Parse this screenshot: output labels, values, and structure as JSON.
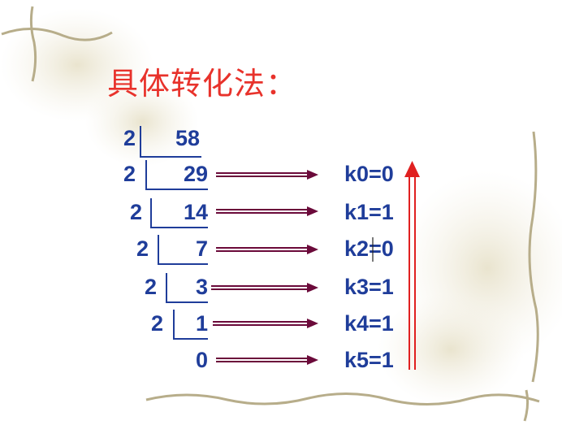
{
  "title": "具体转化法：",
  "division": {
    "divisor": "2",
    "rows": [
      {
        "divisor": "2",
        "value": "58"
      },
      {
        "divisor": "2",
        "value": "29"
      },
      {
        "divisor": "2",
        "value": "14"
      },
      {
        "divisor": "2",
        "value": "7"
      },
      {
        "divisor": "2",
        "value": "3"
      },
      {
        "divisor": "2",
        "value": "1"
      },
      {
        "divisor": "",
        "value": "0"
      }
    ]
  },
  "remainders": [
    {
      "label": "k0=0"
    },
    {
      "label": "k1=1"
    },
    {
      "label": "k2=0"
    },
    {
      "label": "k3=1"
    },
    {
      "label": "k4=1"
    },
    {
      "label": "k5=1"
    }
  ],
  "colors": {
    "title": "#e8322b",
    "text": "#1f3d9a",
    "arrow": "#6b0a3a",
    "up_arrow": "#e02020"
  }
}
